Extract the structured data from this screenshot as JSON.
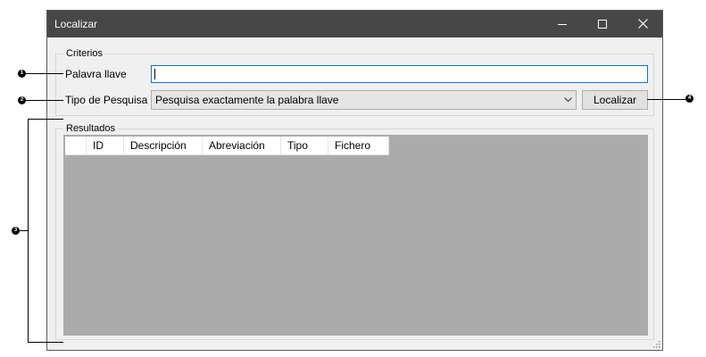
{
  "window": {
    "title": "Localizar",
    "controls": {
      "minimize": "minimize-icon",
      "maximize": "maximize-icon",
      "close": "close-icon"
    }
  },
  "criterios": {
    "group_label": "Criterios",
    "keyword_label": "Palavra llave",
    "keyword_value": "",
    "search_type_label": "Tipo de Pesquisa",
    "search_type_selected": "Pesquisa exactamente la palabra llave",
    "search_button": "Localizar"
  },
  "resultados": {
    "group_label": "Resultados",
    "columns": [
      "",
      "ID",
      "Descripción",
      "Abreviación",
      "Tipo",
      "Fichero"
    ]
  },
  "callouts": [
    "1",
    "2",
    "3",
    "4"
  ],
  "colors": {
    "titlebar": "#474747",
    "grid_background": "#ababab",
    "focus_border": "#0078d7"
  }
}
